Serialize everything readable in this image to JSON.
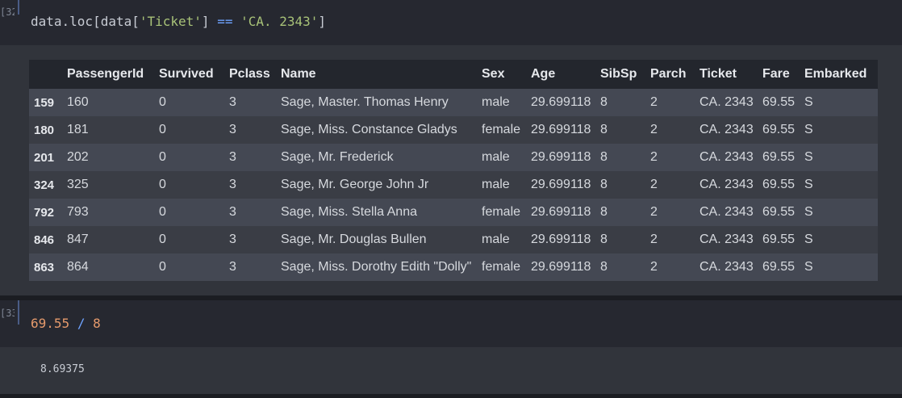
{
  "cells": [
    {
      "prompt": "[32]:",
      "code_parts": [
        "data.loc[data[",
        "'Ticket'",
        "] ",
        "==",
        " ",
        "'CA. 2343'",
        "]"
      ]
    },
    {
      "prompt": "[33]:",
      "code_parts": [
        "69.55",
        " ",
        "/",
        " ",
        "8"
      ],
      "output": "8.69375"
    }
  ],
  "table": {
    "columns": [
      "",
      "PassengerId",
      "Survived",
      "Pclass",
      "Name",
      "Sex",
      "Age",
      "SibSp",
      "Parch",
      "Ticket",
      "Fare",
      "Embarked"
    ],
    "rows": [
      [
        "159",
        "160",
        "0",
        "3",
        "Sage, Master. Thomas Henry",
        "male",
        "29.699118",
        "8",
        "2",
        "CA. 2343",
        "69.55",
        "S"
      ],
      [
        "180",
        "181",
        "0",
        "3",
        "Sage, Miss. Constance Gladys",
        "female",
        "29.699118",
        "8",
        "2",
        "CA. 2343",
        "69.55",
        "S"
      ],
      [
        "201",
        "202",
        "0",
        "3",
        "Sage, Mr. Frederick",
        "male",
        "29.699118",
        "8",
        "2",
        "CA. 2343",
        "69.55",
        "S"
      ],
      [
        "324",
        "325",
        "0",
        "3",
        "Sage, Mr. George John Jr",
        "male",
        "29.699118",
        "8",
        "2",
        "CA. 2343",
        "69.55",
        "S"
      ],
      [
        "792",
        "793",
        "0",
        "3",
        "Sage, Miss. Stella Anna",
        "female",
        "29.699118",
        "8",
        "2",
        "CA. 2343",
        "69.55",
        "S"
      ],
      [
        "846",
        "847",
        "0",
        "3",
        "Sage, Mr. Douglas Bullen",
        "male",
        "29.699118",
        "8",
        "2",
        "CA. 2343",
        "69.55",
        "S"
      ],
      [
        "863",
        "864",
        "0",
        "3",
        "Sage, Miss. Dorothy Edith \"Dolly\"",
        "female",
        "29.699118",
        "8",
        "2",
        "CA. 2343",
        "69.55",
        "S"
      ]
    ]
  },
  "colors": {
    "background": "#2b2d33",
    "string": "#a8c278",
    "operator": "#6fa3ff",
    "number": "#e59a6c"
  }
}
